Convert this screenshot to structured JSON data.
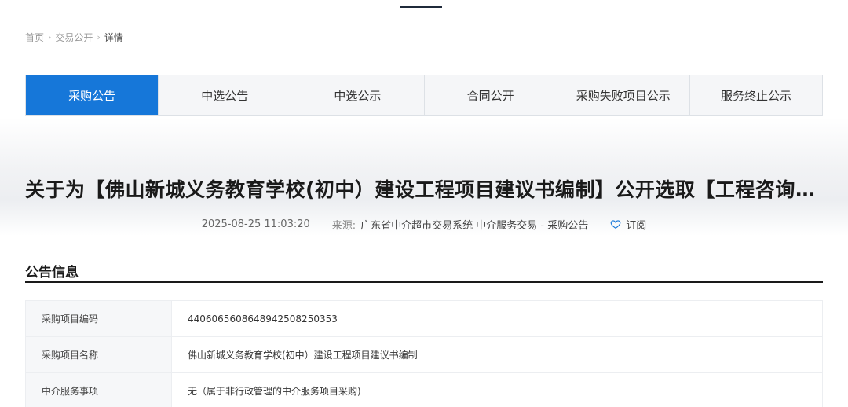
{
  "breadcrumb": {
    "home": "首页",
    "section": "交易公开",
    "current": "详情",
    "separator": "›"
  },
  "tabs": [
    {
      "label": "采购公告",
      "active": true
    },
    {
      "label": "中选公告",
      "active": false
    },
    {
      "label": "中选公示",
      "active": false
    },
    {
      "label": "合同公开",
      "active": false
    },
    {
      "label": "采购失败项目公示",
      "active": false
    },
    {
      "label": "服务终止公示",
      "active": false
    }
  ],
  "notice": {
    "title": "关于为【佛山新城义务教育学校(初中）建设工程项目建议书编制】公开选取【工程咨询机构】的公告",
    "date": "2025-08-25 11:03:20",
    "source_label": "来源:",
    "source": "广东省中介超市交易系统 中介服务交易 - 采购公告",
    "subscribe_label": "订阅",
    "subscribe_icon": "heart-outline-icon"
  },
  "info": {
    "section_title": "公告信息",
    "rows": [
      {
        "label": "采购项目编码",
        "value": "440606560864894250825035 3"
      },
      {
        "label": "采购项目名称",
        "value": "佛山新城义务教育学校(初中）建设工程项目建议书编制"
      },
      {
        "label": "中介服务事项",
        "value": "无（属于非行政管理的中介服务项目采购)"
      }
    ]
  },
  "colors": {
    "accent": "#1677d9",
    "tab_bg": "#f5f6f8",
    "heading": "#1a1a1a"
  }
}
